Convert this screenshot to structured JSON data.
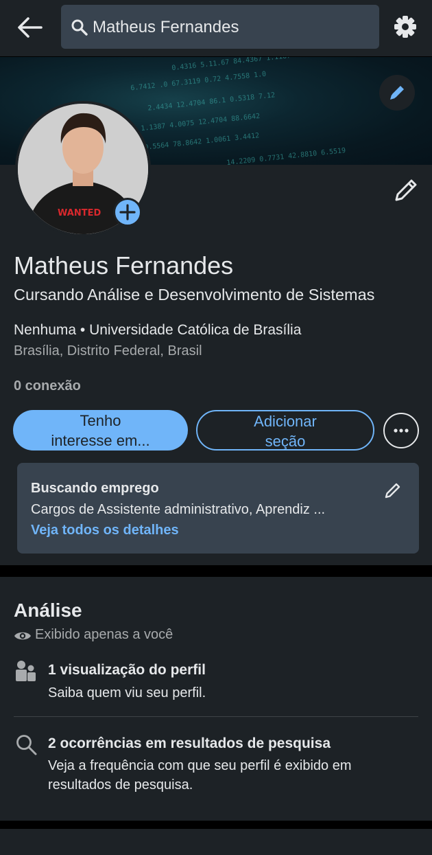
{
  "search": {
    "value": "Matheus Fernandes"
  },
  "banner": {
    "rows": [
      "0.4316  5.11.67  84.4367  1.1187",
      "6.7412 .0 67.3119  0.72  4.7558 1.0",
      "2.4434  12.4704  86.1  0.5318 7.12",
      "1.1387  4.0075  12.4704  88.6642",
      "0.5564 78.8642  1.0061  3.4412",
      "14.2209  0.7731  42.8810  6.5519"
    ]
  },
  "profile": {
    "name": "Matheus Fernandes",
    "headline": "Cursando Análise e Desenvolvimento de Sistemas",
    "education": "Nenhuma • Universidade Católica de Brasília",
    "location": "Brasília, Distrito Federal, Brasil",
    "connections": "0 conexão",
    "shirt_text": "WANTED",
    "primary_button": {
      "line1": "Tenho",
      "line2": "interesse em..."
    },
    "secondary_button": {
      "line1": "Adicionar",
      "line2": "seção"
    }
  },
  "open_to_work": {
    "title": "Buscando emprego",
    "description": "Cargos de Assistente administrativo, Aprendiz ...",
    "link": "Veja todos os detalhes"
  },
  "analytics": {
    "title": "Análise",
    "privacy": "Exibido apenas a você",
    "items": [
      {
        "icon": "people-icon",
        "title": "1 visualização do perfil",
        "subtitle": "Saiba quem viu seu perfil."
      },
      {
        "icon": "search-icon",
        "title": "2 ocorrências em resultados de pesquisa",
        "subtitle": "Veja a frequência com que seu perfil é exibido em resultados de pesquisa."
      }
    ]
  },
  "colors": {
    "background": "#1d2226",
    "accent": "#70b5f9",
    "surface": "#38434f",
    "muted_text": "#a8abad"
  }
}
